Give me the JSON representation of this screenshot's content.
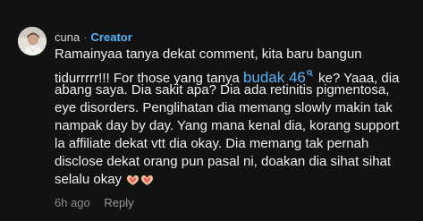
{
  "comment": {
    "username": "cuna",
    "separator": "·",
    "badge": "Creator",
    "avatar_icon": "profile-photo-avatar",
    "text": {
      "line1": "Ramainyaa tanya dekat comment, kita baru bangun",
      "line2_before": "tidurrrrr!!! For those yang tanya ",
      "line2_link": "budak 46",
      "line2_after": " ke? Yaaa, dia",
      "line3": "abang saya. Dia sakit apa? Dia ada retinitis pigmentosa,",
      "line4": "eye disorders. Penglihatan dia memang slowly makin tak",
      "line5": "nampak day by day. Yang mana kenal dia, korang support",
      "line6": "la affiliate dekat vtt dia okay. Dia memang tak pernah",
      "line7": "disclose dekat orang pun pasal ni, doakan dia sihat sihat",
      "line8": "selalu okay"
    },
    "link_icon": "search-icon",
    "emoji_icon": "heart-hands-emoji",
    "timestamp": "6h ago",
    "reply_label": "Reply"
  },
  "colors": {
    "background": "#121212",
    "accent": "#5ab2f6",
    "text": "#f0f0f0",
    "muted": "#8a8a8a"
  }
}
